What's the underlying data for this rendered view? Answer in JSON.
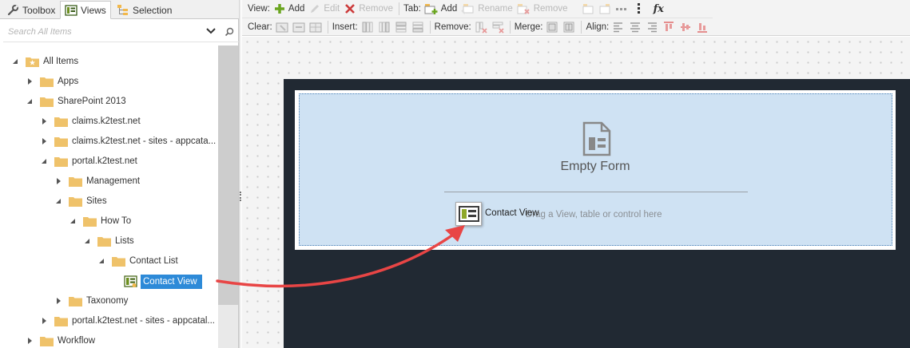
{
  "tabs": [
    {
      "label": "Toolbox",
      "icon": "wrench-icon"
    },
    {
      "label": "Views",
      "icon": "view-icon",
      "active": true
    },
    {
      "label": "Selection",
      "icon": "selection-tree-icon"
    }
  ],
  "search": {
    "placeholder": "Search All Items"
  },
  "tree": [
    {
      "label": "All Items",
      "icon": "star-folder-icon",
      "expanded": true
    },
    {
      "label": "Apps",
      "icon": "folder-icon",
      "expanded": false
    },
    {
      "label": "SharePoint 2013",
      "icon": "folder-icon",
      "expanded": true
    },
    {
      "label": "claims.k2test.net",
      "icon": "folder-icon",
      "expanded": false
    },
    {
      "label": "claims.k2test.net - sites - appcata...",
      "icon": "folder-icon",
      "expanded": false
    },
    {
      "label": "portal.k2test.net",
      "icon": "folder-icon",
      "expanded": true
    },
    {
      "label": "Management",
      "icon": "folder-icon",
      "expanded": false
    },
    {
      "label": "Sites",
      "icon": "folder-icon",
      "expanded": true
    },
    {
      "label": "How To",
      "icon": "folder-icon",
      "expanded": true
    },
    {
      "label": "Lists",
      "icon": "folder-icon",
      "expanded": true
    },
    {
      "label": "Contact List",
      "icon": "folder-icon",
      "expanded": true
    },
    {
      "label": "Contact View",
      "icon": "view-item-icon",
      "selected": true
    },
    {
      "label": "Taxonomy",
      "icon": "folder-icon",
      "expanded": false
    },
    {
      "label": "portal.k2test.net - sites - appcatal...",
      "icon": "folder-icon",
      "expanded": false
    },
    {
      "label": "Workflow",
      "icon": "folder-icon",
      "expanded": false
    }
  ],
  "toolbar": {
    "view_label": "View:",
    "view_add": "Add",
    "view_edit": "Edit",
    "view_remove": "Remove",
    "tab_label": "Tab:",
    "tab_add": "Add",
    "tab_rename": "Rename",
    "tab_remove": "Remove",
    "fx": "fx",
    "clear_label": "Clear:",
    "insert_label": "Insert:",
    "remove_label": "Remove:",
    "merge_label": "Merge:",
    "align_label": "Align:"
  },
  "form": {
    "empty_title": "Empty Form",
    "drop_hint": "Drag a View, table or control here",
    "drag_item_label": "Contact View"
  },
  "colors": {
    "selection": "#2d8ad8",
    "dropzone": "#cfe2f3",
    "form_background": "#212933",
    "drag_arrow": "#e84545",
    "add_icon": "#6aa51f",
    "remove_icon": "#cc3b3b"
  }
}
